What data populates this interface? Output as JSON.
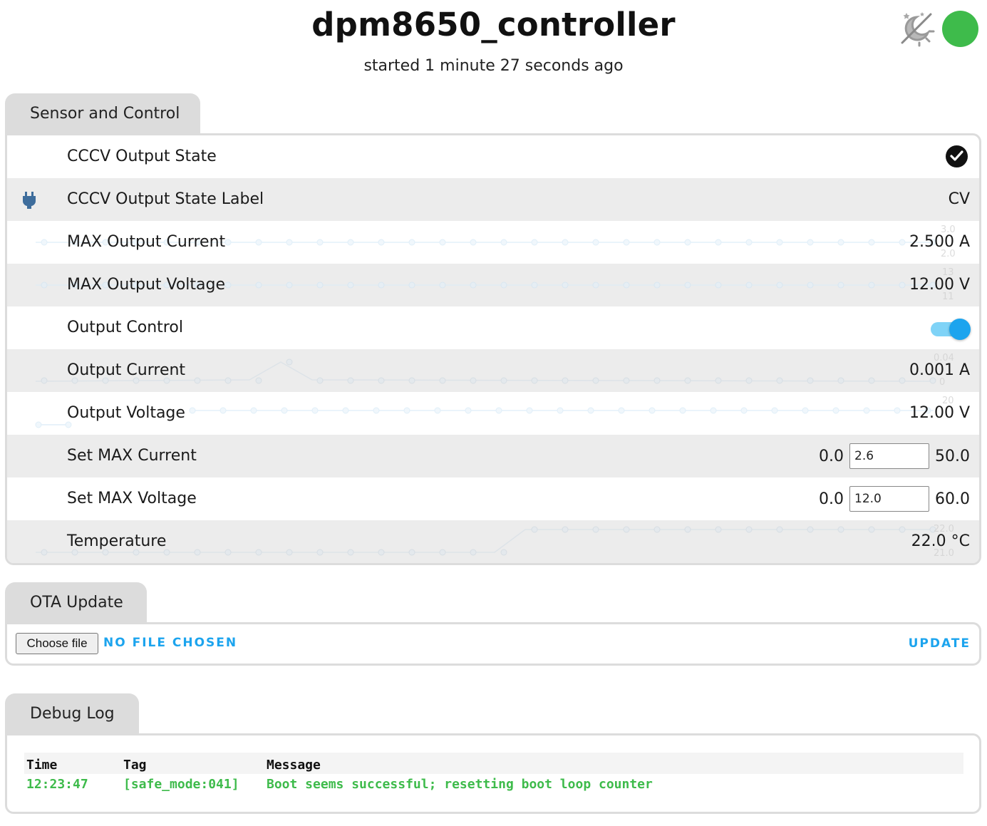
{
  "header": {
    "title": "dpm8650_controller",
    "subtitle": "started 1 minute 27 seconds ago",
    "status_color": "#3ebb4b",
    "theme_icon": "theme-toggle-icon"
  },
  "sensors": {
    "tab_label": "Sensor and Control",
    "rows": [
      {
        "label": "CCCV Output State",
        "kind": "binary",
        "value": true
      },
      {
        "label": "CCCV Output State Label",
        "kind": "text",
        "value": "CV",
        "icon": "power-plug-icon"
      },
      {
        "label": "MAX Output Current",
        "kind": "sensor",
        "value": "2.500 A",
        "spark_hi": "3.0",
        "spark_lo": "2.0"
      },
      {
        "label": "MAX Output Voltage",
        "kind": "sensor",
        "value": "12.00 V",
        "spark_hi": "13",
        "spark_lo": "11"
      },
      {
        "label": "Output Control",
        "kind": "switch",
        "value": true
      },
      {
        "label": "Output Current",
        "kind": "sensor",
        "value": "0.001 A",
        "spark_hi": "0.04",
        "spark_lo": "0"
      },
      {
        "label": "Output Voltage",
        "kind": "sensor",
        "value": "12.00 V",
        "spark_hi": "20",
        "spark_lo": ""
      },
      {
        "label": "Set MAX Current",
        "kind": "number",
        "min": "0.0",
        "value": "2.6",
        "max": "50.0"
      },
      {
        "label": "Set MAX Voltage",
        "kind": "number",
        "min": "0.0",
        "value": "12.0",
        "max": "60.0"
      },
      {
        "label": "Temperature",
        "kind": "sensor",
        "value": "22.0 °C",
        "spark_hi": "22.0",
        "spark_lo": "21.0"
      }
    ]
  },
  "ota": {
    "tab_label": "OTA Update",
    "choose_label": "Choose file",
    "file_status": "NO FILE CHOSEN",
    "update_label": "UPDATE"
  },
  "log": {
    "tab_label": "Debug Log",
    "columns": [
      "Time",
      "Tag",
      "Message"
    ],
    "entries": [
      {
        "time": "12:23:47",
        "tag": "[safe_mode:041]",
        "message": "Boot seems successful; resetting boot loop counter"
      }
    ],
    "entry_color": "#3ebb4b"
  },
  "colors": {
    "accent": "#1ca4ee",
    "panel_border": "#dcdcdc",
    "row_alt": "#ececec"
  }
}
